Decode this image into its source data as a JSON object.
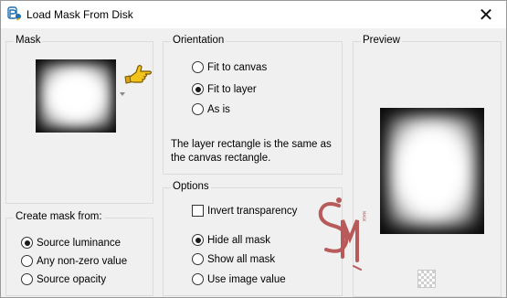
{
  "window": {
    "title": "Load Mask From Disk",
    "close_glyph": "✕"
  },
  "mask": {
    "label": "Mask",
    "thumbnail_icon": "mask-thumbnail",
    "pointer_icon": "pointing-hand-icon"
  },
  "orientation": {
    "label": "Orientation",
    "options": [
      {
        "label": "Fit to canvas",
        "selected": false
      },
      {
        "label": "Fit to layer",
        "selected": true
      },
      {
        "label": "As is",
        "selected": false
      }
    ],
    "description": "The layer rectangle is the same as the canvas rectangle."
  },
  "preview": {
    "label": "Preview"
  },
  "create_mask": {
    "label": "Create mask from:",
    "options": [
      {
        "label": "Source luminance",
        "selected": true
      },
      {
        "label": "Any non-zero value",
        "selected": false
      },
      {
        "label": "Source opacity",
        "selected": false
      }
    ]
  },
  "options": {
    "label": "Options",
    "invert_label": "Invert transparency",
    "invert_checked": false,
    "radios": [
      {
        "label": "Hide all mask",
        "selected": true
      },
      {
        "label": "Show all mask",
        "selected": false
      },
      {
        "label": "Use image value",
        "selected": false
      }
    ]
  },
  "colors": {
    "watermark": "#b85a5a",
    "hand": "#f0c419"
  }
}
